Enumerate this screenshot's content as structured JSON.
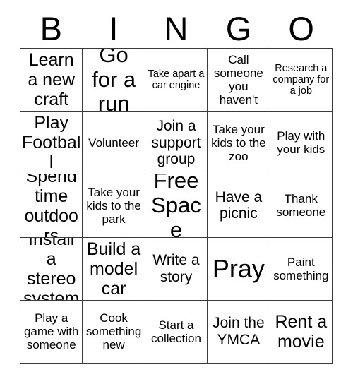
{
  "card": {
    "title_letters": [
      "B",
      "I",
      "N",
      "G",
      "O"
    ],
    "columns": 5,
    "rows": 5,
    "free_space_index": 12,
    "colors": {
      "background": "#ffffff",
      "text": "#000000",
      "grid_line": "#3a3a3a"
    },
    "cells": [
      {
        "text": "Learn a new craft",
        "size": "lg"
      },
      {
        "text": "Go for a run",
        "size": "xl"
      },
      {
        "text": "Take apart a car engine",
        "size": "xs"
      },
      {
        "text": "Call someone you haven't",
        "size": "sm"
      },
      {
        "text": "Research a company for a job",
        "size": "xs"
      },
      {
        "text": "Play Football",
        "size": "lg"
      },
      {
        "text": "Volunteer",
        "size": "sm"
      },
      {
        "text": "Join a support group",
        "size": "md"
      },
      {
        "text": "Take your kids to the zoo",
        "size": "sm"
      },
      {
        "text": "Play with your kids",
        "size": "sm"
      },
      {
        "text": "Spend time outdoors",
        "size": "lg"
      },
      {
        "text": "Take your kids to the park",
        "size": "sm"
      },
      {
        "text": "Free Space",
        "size": "xl"
      },
      {
        "text": "Have a picnic",
        "size": "md"
      },
      {
        "text": "Thank someone",
        "size": "sm"
      },
      {
        "text": "Install a stereo system",
        "size": "lg"
      },
      {
        "text": "Build a model car",
        "size": "lg"
      },
      {
        "text": "Write a story",
        "size": "md"
      },
      {
        "text": "Pray",
        "size": "xxl"
      },
      {
        "text": "Paint something",
        "size": "sm"
      },
      {
        "text": "Play a game with someone",
        "size": "sm"
      },
      {
        "text": "Cook something new",
        "size": "sm"
      },
      {
        "text": "Start a collection",
        "size": "sm"
      },
      {
        "text": "Join the YMCA",
        "size": "md"
      },
      {
        "text": "Rent a movie",
        "size": "lg"
      }
    ]
  }
}
